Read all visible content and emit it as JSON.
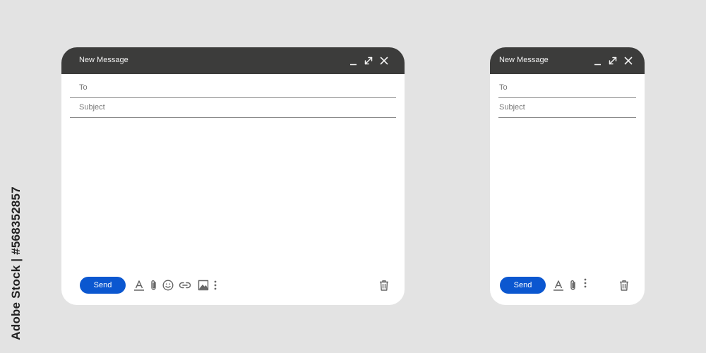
{
  "watermark": {
    "text": "Adobe Stock | #568352857"
  },
  "windows": [
    {
      "title": "New Message",
      "to_label": "To",
      "subject_label": "Subject",
      "send_label": "Send",
      "toolbar_icons": [
        "format-text-icon",
        "attach-icon",
        "emoji-icon",
        "link-icon",
        "image-icon",
        "more-options-icon"
      ],
      "window_controls": [
        "minimize-icon",
        "expand-icon",
        "close-icon"
      ]
    },
    {
      "title": "New Message",
      "to_label": "To",
      "subject_label": "Subject",
      "send_label": "Send",
      "toolbar_icons": [
        "format-text-icon",
        "attach-icon",
        "more-options-icon"
      ],
      "window_controls": [
        "minimize-icon",
        "expand-icon",
        "close-icon"
      ]
    }
  ],
  "colors": {
    "background": "#e3e3e3",
    "titlebar": "#3c3c3b",
    "send_button": "#0b57d0",
    "field_line": "#8a8a8a",
    "icon": "#666666"
  }
}
